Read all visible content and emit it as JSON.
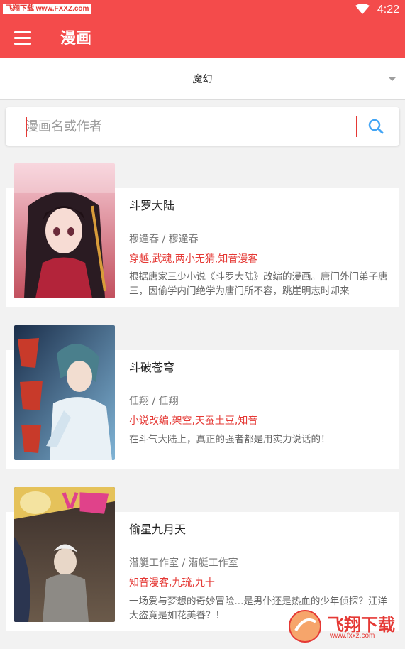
{
  "status_bar": {
    "watermark": "飞翔下载 www.FXXZ.com",
    "time": "4:22"
  },
  "app_bar": {
    "title": "漫画"
  },
  "category": {
    "selected": "魔幻"
  },
  "search": {
    "placeholder": "漫画名或作者"
  },
  "comics": [
    {
      "title": "斗罗大陆",
      "author": "穆逢春 / 穆逢春",
      "tags": "穿越,武魂,两小无猜,知音漫客",
      "description": "根据唐家三少小说《斗罗大陆》改编的漫画。唐门外门弟子唐三，因偷学内门绝学为唐门所不容，跳崖明志时却来"
    },
    {
      "title": "斗破苍穹",
      "author": "任翔 / 任翔",
      "tags": "小说改编,架空,天蚕土豆,知音",
      "description": "在斗气大陆上，真正的强者都是用实力说话的！"
    },
    {
      "title": "偷星九月天",
      "author": "潜艇工作室 / 潜艇工作室",
      "tags": "知音漫客,九琉,九十",
      "description": "一场爱与梦想的奇妙冒险...是男仆还是热血的少年侦探？江洋大盗竟是如花美眷？！"
    }
  ],
  "watermark_logo": {
    "name": "飞翔下载",
    "url": "www.fxxz.com"
  },
  "colors": {
    "primary": "#f44b4b",
    "tag_red": "#e53935",
    "search_icon": "#42a5f5"
  }
}
